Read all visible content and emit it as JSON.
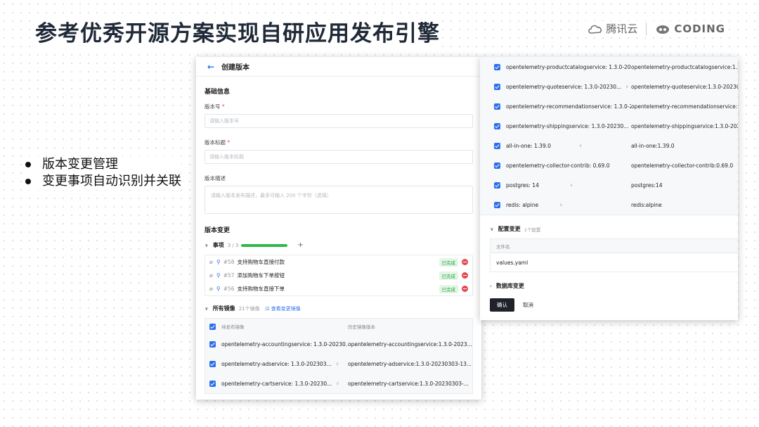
{
  "slide": {
    "title": "参考优秀开源方案实现自研应用发布引擎"
  },
  "logos": {
    "tencent": "腾讯云",
    "coding": "CODING"
  },
  "bullets": [
    "版本变更管理",
    "变更事项自动识别并关联"
  ],
  "form": {
    "header": {
      "back": "←",
      "title": "创建版本"
    },
    "basic_section": "基础信息",
    "version_no": {
      "label": "版本号",
      "required": "*",
      "placeholder": "请输入版本号"
    },
    "version_title": {
      "label": "版本标题",
      "required": "*",
      "placeholder": "请输入版本标题"
    },
    "version_desc": {
      "label": "版本描述",
      "placeholder": "请输入版本发布描述，最多可输入 200 个字符（选填）"
    },
    "change_section": "版本变更",
    "issues": {
      "label": "事项",
      "count": "3 / 3",
      "progress": 1.0,
      "add": "+",
      "items": [
        {
          "num": "#58",
          "name": "支持购物车直接付款",
          "status": "已完成"
        },
        {
          "num": "#57",
          "name": "添加购物车下单按钮",
          "status": "已完成"
        },
        {
          "num": "#56",
          "name": "支持购物车直接下单",
          "status": "已完成"
        }
      ]
    },
    "images": {
      "label": "所有镜像",
      "count": "21个镜像",
      "link": "查看变更镜像",
      "col_pending": "待发布镜像",
      "col_history": "历史镜像版本",
      "rows": [
        {
          "image": "opentelemetry-accountingservice:  1.3.0-20230...",
          "history": "opentelemetry-accountingservice:1.3.0-2023..."
        },
        {
          "image": "opentelemetry-adservice:  1.3.0-202303...",
          "history": "opentelemetry-adservice:1.3.0-20230303-13..."
        },
        {
          "image": "opentelemetry-cartservice:  1.3.0-20230...",
          "history": "opentelemetry-cartservice:1.3.0-20230303-..."
        }
      ]
    }
  },
  "right": {
    "rows": [
      {
        "image": "opentelemetry-productcatalogservice:  1.3.0-202",
        "history": "opentelemetry-productcatalogservice:1.3.0-"
      },
      {
        "image": "opentelemetry-quoteservice:  1.3.0-20230...",
        "history": "opentelemetry-quoteservice:1.3.0-20230303"
      },
      {
        "image": "opentelemetry-recommendationservice:  1.3.0-2(",
        "history": "opentelemetry-recommendationservice:1.3."
      },
      {
        "image": "opentelemetry-shippingservice:  1.3.0-20230...",
        "history": "opentelemetry-shippingservice:1.3.0-20230"
      },
      {
        "image": "all-in-one:  1.39.0",
        "history": "all-in-one:1.39.0"
      },
      {
        "image": "opentelemetry-collector-contrib:  0.69.0",
        "history": "opentelemetry-collector-contrib:0.69.0"
      },
      {
        "image": "postgres:  14",
        "history": "postgres:14"
      },
      {
        "image": "redis:  alpine",
        "history": "redis:alpine"
      }
    ],
    "config": {
      "label": "配置变更",
      "count": "1个配置",
      "col_file": "文件名",
      "file": "values.yaml"
    },
    "db": {
      "label": "数据库变更"
    },
    "confirm": "确认",
    "cancel": "取消"
  }
}
